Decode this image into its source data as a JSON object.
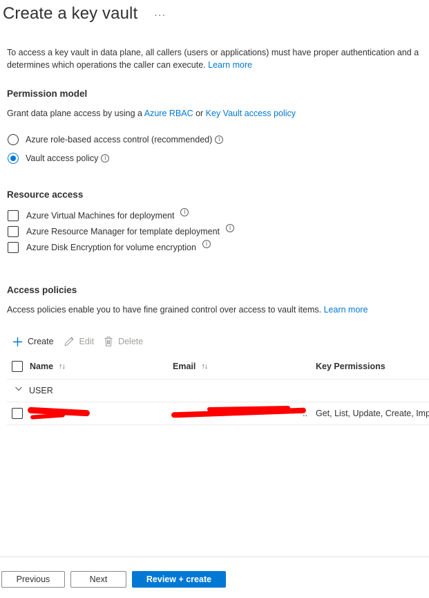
{
  "page": {
    "title": "Create a key vault",
    "more_label": "···"
  },
  "intro": {
    "line1": "To access a key vault in data plane, all callers (users or applications) must have proper authentication and a",
    "line2": "determines which operations the caller can execute.",
    "learn_more": "Learn more"
  },
  "permission_model": {
    "heading": "Permission model",
    "desc_prefix": "Grant data plane access by using a ",
    "link_rbac": "Azure RBAC",
    "desc_mid": " or ",
    "link_policy": "Key Vault access policy",
    "options": [
      {
        "label": "Azure role-based access control (recommended)",
        "selected": false
      },
      {
        "label": "Vault access policy",
        "selected": true
      }
    ]
  },
  "resource_access": {
    "heading": "Resource access",
    "options": [
      {
        "label": "Azure Virtual Machines for deployment",
        "checked": false
      },
      {
        "label": "Azure Resource Manager for template deployment",
        "checked": false
      },
      {
        "label": "Azure Disk Encryption for volume encryption",
        "checked": false
      }
    ]
  },
  "access_policies": {
    "heading": "Access policies",
    "desc": "Access policies enable you to have fine grained control over access to vault items.",
    "learn_more": "Learn more",
    "toolbar": {
      "create": "Create",
      "edit": "Edit",
      "delete": "Delete"
    },
    "columns": {
      "name": "Name",
      "email": "Email",
      "key_permissions": "Key Permissions"
    },
    "group": "USER",
    "rows": [
      {
        "email_tail": "..",
        "key_permissions": "Get, List, Update, Create, Imp"
      }
    ]
  },
  "footer": {
    "previous": "Previous",
    "next": "Next",
    "review_create": "Review + create"
  },
  "colors": {
    "accent": "#0078d4",
    "redaction": "#ff0000"
  }
}
